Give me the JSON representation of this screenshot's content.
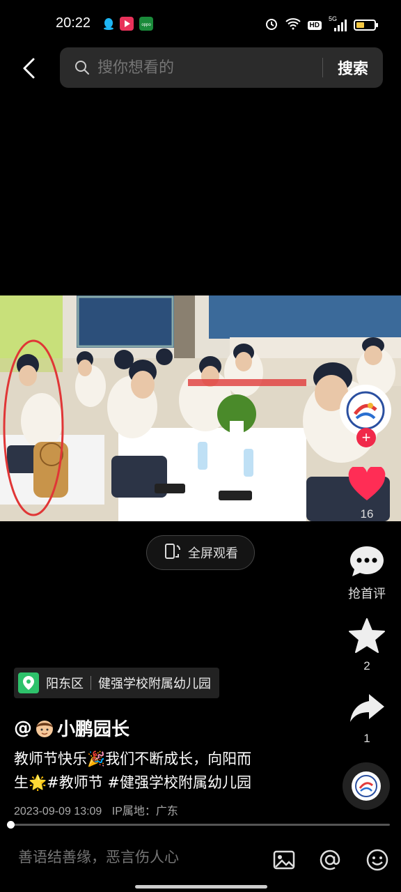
{
  "status_bar": {
    "time": "20:22",
    "hd": "HD",
    "net": "5G",
    "battery_level": 0.35,
    "apps": [
      "qq-icon",
      "video-app-icon",
      "oppo-icon"
    ]
  },
  "header": {
    "search_placeholder": "搜你想看的",
    "search_button": "搜索"
  },
  "video": {
    "fullscreen_label": "全屏观看",
    "progress": 0.01
  },
  "actions": {
    "likes": "16",
    "comment_label": "抢首评",
    "favorites": "2",
    "shares": "1"
  },
  "post": {
    "location_area": "阳东区",
    "location_name": "健强学校附属幼儿园",
    "author_at": "@",
    "author_name": "小鹏园长",
    "caption_line1": "教师节快乐🎉我们不断成长，向阳而",
    "caption_line2": "生🌟#教师节 #健强学校附属幼儿园",
    "date": "2023-09-09 13:09",
    "ip_location": "IP属地：广东"
  },
  "comment_bar": {
    "placeholder": "善语结善缘，恶言伤人心"
  },
  "colors": {
    "like": "#ff2d55",
    "follow": "#f0294a",
    "location": "#2ec26b",
    "background": "#000000"
  }
}
